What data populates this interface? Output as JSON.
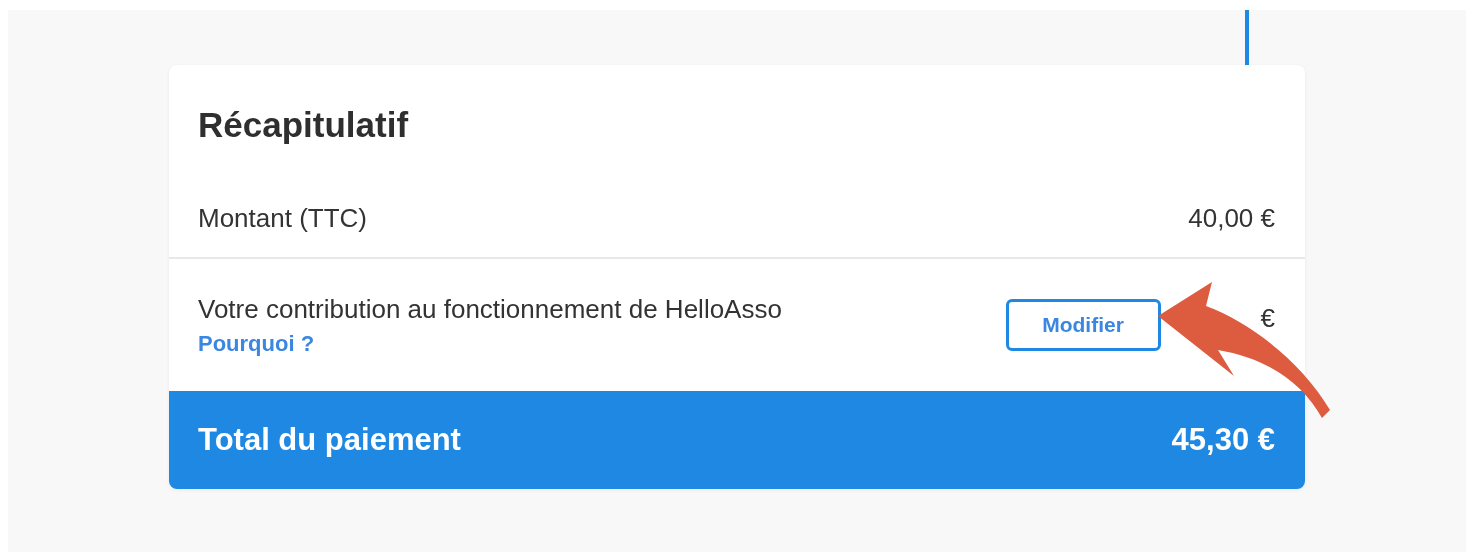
{
  "summary": {
    "title": "Récapitulatif",
    "rows": [
      {
        "kind": "plain",
        "label": "Montant (TTC)",
        "amount": "40,00 €"
      },
      {
        "kind": "contribution",
        "label": "Votre contribution au fonctionnement de HelloAsso",
        "link": "Pourquoi ?",
        "button": "Modifier",
        "amount": "€"
      }
    ],
    "total": {
      "label": "Total du paiement",
      "amount": "45,30 €"
    }
  }
}
